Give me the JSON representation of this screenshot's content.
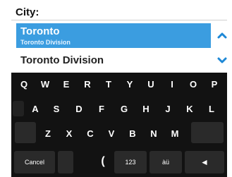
{
  "field": {
    "label": "City:"
  },
  "list": {
    "items": [
      {
        "title": "Toronto",
        "subtitle": "Toronto Division",
        "selected": true
      },
      {
        "title": "Toronto Division",
        "subtitle": "",
        "selected": false
      }
    ]
  },
  "arrows": {
    "up_color": "#1e88d6",
    "down_color": "#1e88d6"
  },
  "keyboard": {
    "row1": [
      "Q",
      "W",
      "E",
      "R",
      "T",
      "Y",
      "U",
      "I",
      "O",
      "P"
    ],
    "row2": [
      "A",
      "S",
      "D",
      "F",
      "G",
      "H",
      "J",
      "K",
      "L"
    ],
    "row3": [
      "Z",
      "X",
      "C",
      "V",
      "B",
      "N",
      "M"
    ],
    "bottom": {
      "cancel": "Cancel",
      "paren": "(",
      "numbers": "123",
      "accents": "àü",
      "enter": "◄"
    }
  },
  "colors": {
    "accent": "#3b9de0",
    "keyboard_bg": "#121212"
  }
}
